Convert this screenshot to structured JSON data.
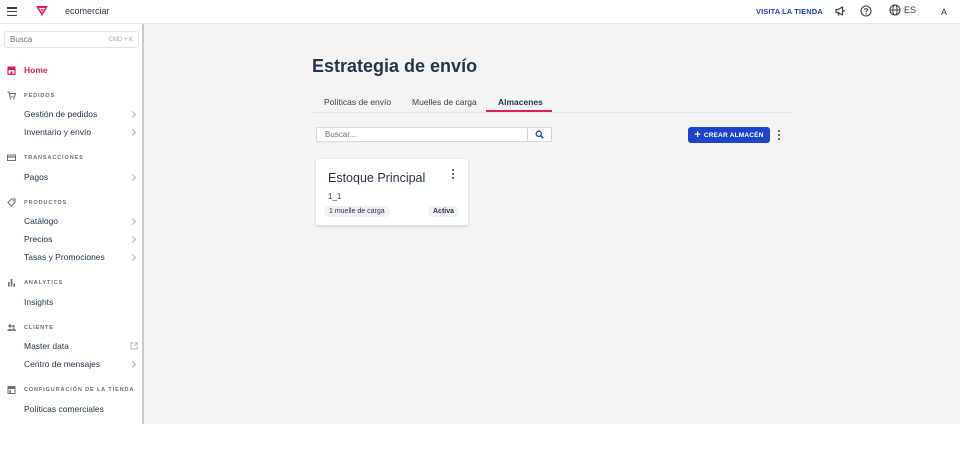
{
  "header": {
    "account_name": "ecomerciar",
    "visit_store": "VISITA LA TIENDA",
    "language": "ES",
    "avatar_initial": "A"
  },
  "sidebar": {
    "search_placeholder": "Busca",
    "search_shortcut": "CMD + K",
    "home_label": "Home",
    "sections": {
      "pedidos": "PEDIDOS",
      "transacciones": "TRANSACCIONES",
      "productos": "PRODUCTOS",
      "analytics": "ANALYTICS",
      "cliente": "CLIENTE",
      "configuracion": "CONFIGURACIÓN DE LA TIENDA"
    },
    "items": {
      "gestion_pedidos": "Gestión de pedidos",
      "inventario_envio": "Inventario y envío",
      "pagos": "Pagos",
      "catalogo": "Catálogo",
      "precios": "Precios",
      "tasas_promociones": "Tasas y Promociones",
      "insights": "Insights",
      "master_data": "Master data",
      "centro_mensajes": "Centro de mensajes",
      "politicas_comerciales": "Políticas comerciales"
    }
  },
  "main": {
    "title": "Estrategia de envío",
    "tabs": [
      {
        "label": "Políticas de envío",
        "active": false
      },
      {
        "label": "Muelles de carga",
        "active": false
      },
      {
        "label": "Almacenes",
        "active": true
      }
    ],
    "search_placeholder": "Buscar...",
    "create_button": "CREAR ALMACÉN",
    "warehouse_card": {
      "name": "Estoque Principal",
      "id": "1_1",
      "docks": "1 muelle de carga",
      "status": "Activa"
    }
  },
  "colors": {
    "accent_pink": "#e31c58",
    "primary_blue": "#1d44c9",
    "text_dark": "#25354d",
    "background_gray": "#f4f4f5"
  }
}
